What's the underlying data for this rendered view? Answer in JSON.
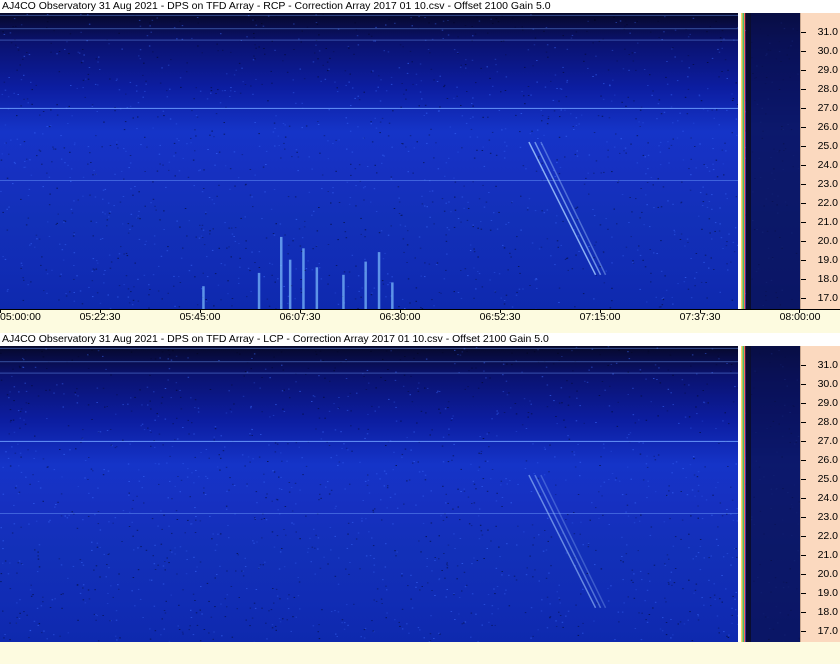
{
  "panels": [
    {
      "title": "AJ4CO Observatory 31 Aug 2021  -  DPS on TFD Array  -  RCP  -  Correction Array 2017 01 10.csv  -  Offset 2100  Gain 5.0"
    },
    {
      "title": "AJ4CO Observatory 31 Aug 2021  -  DPS on TFD Array  -  LCP  -  Correction Array 2017 01 10.csv  -  Offset 2100  Gain 5.0"
    }
  ],
  "chart_data": [
    {
      "type": "heatmap",
      "title": "AJ4CO Observatory 31 Aug 2021  -  DPS on TFD Array  -  RCP  -  Correction Array 2017 01 10.csv  -  Offset 2100  Gain 5.0",
      "polarization": "RCP",
      "x_axis": {
        "ticks": [
          "05:00:00",
          "05:22:30",
          "05:45:00",
          "06:07:30",
          "06:30:00",
          "06:52:30",
          "07:15:00",
          "07:37:30",
          "08:00:00"
        ],
        "range": [
          "05:00:00",
          "08:00:00"
        ]
      },
      "y_axis": {
        "ticks": [
          "17.0",
          "18.0",
          "19.0",
          "20.0",
          "21.0",
          "22.0",
          "23.0",
          "24.0",
          "25.0",
          "26.0",
          "27.0",
          "28.0",
          "29.0",
          "30.0",
          "31.0"
        ],
        "range": [
          16.4,
          32.0
        ]
      },
      "colormap": [
        "#06082a",
        "#0a1270",
        "#1534c8",
        "#4d8bff",
        "#bfe4ff"
      ]
    },
    {
      "type": "heatmap",
      "title": "AJ4CO Observatory 31 Aug 2021  -  DPS on TFD Array  -  LCP  -  Correction Array 2017 01 10.csv  -  Offset 2100  Gain 5.0",
      "polarization": "LCP",
      "x_axis": {
        "ticks": [],
        "range": [
          "05:00:00",
          "08:00:00"
        ]
      },
      "y_axis": {
        "ticks": [
          "17.0",
          "18.0",
          "19.0",
          "20.0",
          "21.0",
          "22.0",
          "23.0",
          "24.0",
          "25.0",
          "26.0",
          "27.0",
          "28.0",
          "29.0",
          "30.0",
          "31.0"
        ],
        "range": [
          16.4,
          32.0
        ]
      },
      "colormap": [
        "#06082a",
        "#0a1270",
        "#1534c8",
        "#4d8bff",
        "#bfe4ff"
      ]
    }
  ]
}
